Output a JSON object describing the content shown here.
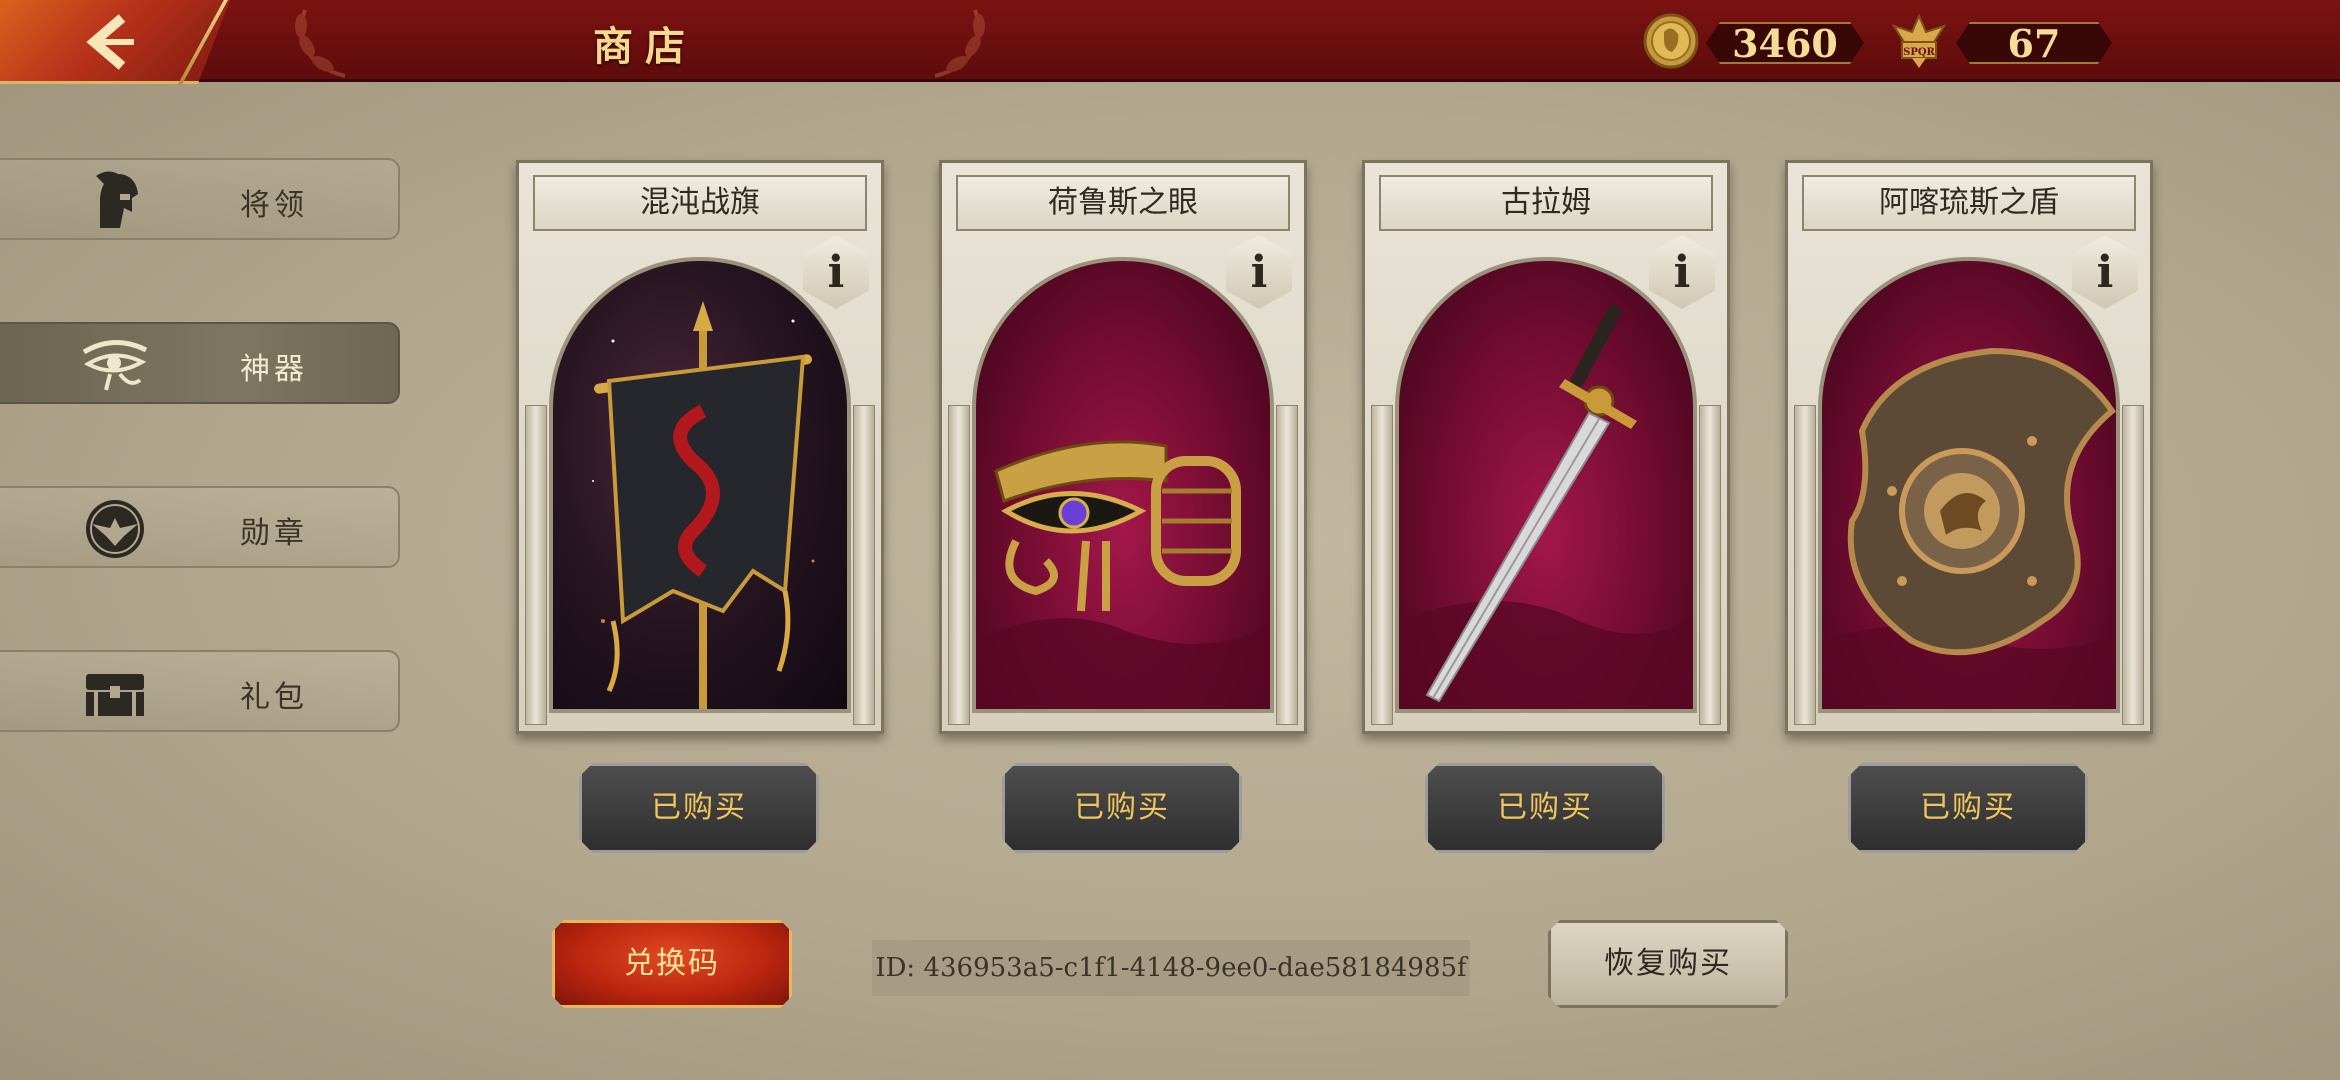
{
  "header": {
    "title": "商店",
    "back_icon": "chevron-left-icon",
    "currencies": [
      {
        "icon": "gold-coin-icon",
        "value": "3460"
      },
      {
        "icon": "spqr-eagle-icon",
        "value": "67"
      }
    ]
  },
  "sidebar": {
    "items": [
      {
        "label": "将领",
        "icon": "spartan-helmet-icon",
        "active": false
      },
      {
        "label": "神器",
        "icon": "eye-of-horus-icon",
        "active": true
      },
      {
        "label": "勋章",
        "icon": "eagle-medal-icon",
        "active": false
      },
      {
        "label": "礼包",
        "icon": "chest-icon",
        "active": false
      }
    ]
  },
  "shop": {
    "items": [
      {
        "name": "混沌战旗",
        "info": "i",
        "art": "chaos-banner-art",
        "status": "已购买"
      },
      {
        "name": "荷鲁斯之眼",
        "info": "i",
        "art": "eye-of-horus-art",
        "status": "已购买"
      },
      {
        "name": "古拉姆",
        "info": "i",
        "art": "sword-art",
        "status": "已购买"
      },
      {
        "name": "阿喀琉斯之盾",
        "info": "i",
        "art": "shield-art",
        "status": "已购买"
      }
    ]
  },
  "footer": {
    "redeem_label": "兑换码",
    "id_text": "ID: 436953a5-c1f1-4148-9ee0-dae58184985f",
    "restore_label": "恢复购买"
  },
  "colors": {
    "header_red": "#6d0f0f",
    "gold_text": "#f1c65a",
    "background": "#b3a88e"
  }
}
